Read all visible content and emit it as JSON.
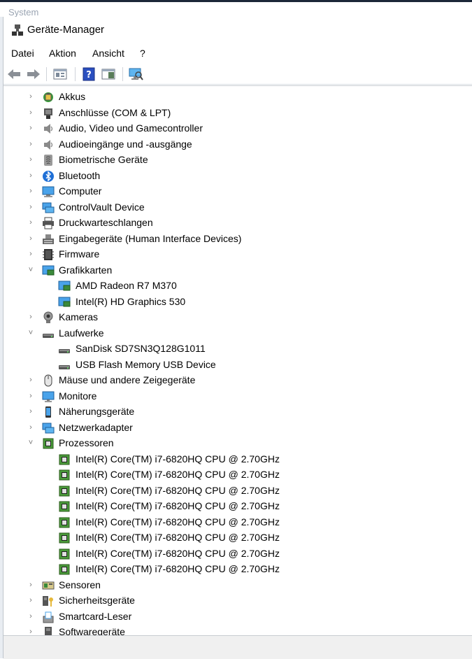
{
  "background_window": {
    "title": "System"
  },
  "window": {
    "title": "Geräte-Manager",
    "icon": "device-manager-icon"
  },
  "menu": {
    "items": [
      "Datei",
      "Aktion",
      "Ansicht",
      "?"
    ]
  },
  "toolbar": {
    "buttons": [
      "back-arrow-icon",
      "forward-arrow-icon",
      "properties-icon",
      "help-icon",
      "view-icon",
      "scan-hardware-icon"
    ]
  },
  "tree": {
    "items": [
      {
        "label": "Akkus",
        "icon": "battery-icon",
        "expanded": false
      },
      {
        "label": "Anschlüsse (COM & LPT)",
        "icon": "port-icon",
        "expanded": false
      },
      {
        "label": "Audio, Video und Gamecontroller",
        "icon": "speaker-icon",
        "expanded": false
      },
      {
        "label": "Audioeingänge und -ausgänge",
        "icon": "speaker-icon",
        "expanded": false
      },
      {
        "label": "Biometrische Geräte",
        "icon": "fingerprint-icon",
        "expanded": false
      },
      {
        "label": "Bluetooth",
        "icon": "bluetooth-icon",
        "expanded": false
      },
      {
        "label": "Computer",
        "icon": "computer-icon",
        "expanded": false
      },
      {
        "label": "ControlVault Device",
        "icon": "network-icon",
        "expanded": false
      },
      {
        "label": "Druckwarteschlangen",
        "icon": "printer-icon",
        "expanded": false
      },
      {
        "label": "Eingabegeräte (Human Interface Devices)",
        "icon": "keyboard-icon",
        "expanded": false
      },
      {
        "label": "Firmware",
        "icon": "chip-icon",
        "expanded": false
      },
      {
        "label": "Grafikkarten",
        "icon": "display-adapter-icon",
        "expanded": true,
        "children": [
          "AMD Radeon R7 M370",
          "Intel(R) HD Graphics 530"
        ]
      },
      {
        "label": "Kameras",
        "icon": "webcam-icon",
        "expanded": false
      },
      {
        "label": "Laufwerke",
        "icon": "disk-drive-icon",
        "expanded": true,
        "children": [
          "SanDisk SD7SN3Q128G1011",
          "USB Flash Memory USB Device"
        ]
      },
      {
        "label": "Mäuse und andere Zeigegeräte",
        "icon": "mouse-icon",
        "expanded": false
      },
      {
        "label": "Monitore",
        "icon": "monitor-icon",
        "expanded": false
      },
      {
        "label": "Näherungsgeräte",
        "icon": "phone-icon",
        "expanded": false
      },
      {
        "label": "Netzwerkadapter",
        "icon": "network-icon",
        "expanded": false
      },
      {
        "label": "Prozessoren",
        "icon": "processor-icon",
        "expanded": true,
        "children": [
          "Intel(R) Core(TM) i7-6820HQ CPU @ 2.70GHz",
          "Intel(R) Core(TM) i7-6820HQ CPU @ 2.70GHz",
          "Intel(R) Core(TM) i7-6820HQ CPU @ 2.70GHz",
          "Intel(R) Core(TM) i7-6820HQ CPU @ 2.70GHz",
          "Intel(R) Core(TM) i7-6820HQ CPU @ 2.70GHz",
          "Intel(R) Core(TM) i7-6820HQ CPU @ 2.70GHz",
          "Intel(R) Core(TM) i7-6820HQ CPU @ 2.70GHz",
          "Intel(R) Core(TM) i7-6820HQ CPU @ 2.70GHz"
        ]
      },
      {
        "label": "Sensoren",
        "icon": "sensor-icon",
        "expanded": false
      },
      {
        "label": "Sicherheitsgeräte",
        "icon": "security-key-icon",
        "expanded": false
      },
      {
        "label": "Smartcard-Leser",
        "icon": "smartcard-reader-icon",
        "expanded": false
      },
      {
        "label": "Softwaregeräte",
        "icon": "software-device-icon",
        "expanded": false
      }
    ]
  },
  "colors": {
    "accent": "#2b79d0",
    "chevron": "#777777",
    "window_border": "#bfc5cc"
  }
}
